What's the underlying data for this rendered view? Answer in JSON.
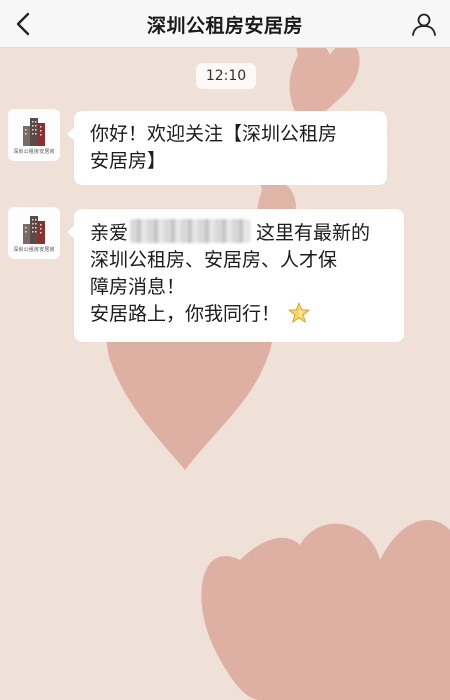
{
  "header": {
    "title": "深圳公租房安居房",
    "back_icon": "back-chevron-icon",
    "profile_icon": "user-profile-icon"
  },
  "chat": {
    "timestamp": "12:10",
    "account_avatar_caption": "深圳公租房安居房",
    "messages": [
      {
        "lines": [
          "你好！欢迎关注【深圳公租房",
          "安居房】"
        ]
      },
      {
        "greeting": "亲爱",
        "after_blur": "这里有最新的",
        "lines": [
          "深圳公租房、安居房、人才保",
          "障房消息！",
          "安居路上，你我同行！"
        ],
        "emoji": "star-icon"
      }
    ]
  },
  "colors": {
    "background": "#efe1d8",
    "heart": "#d9a294",
    "header_bg": "#f7f7f7",
    "bubble": "#ffffff"
  }
}
